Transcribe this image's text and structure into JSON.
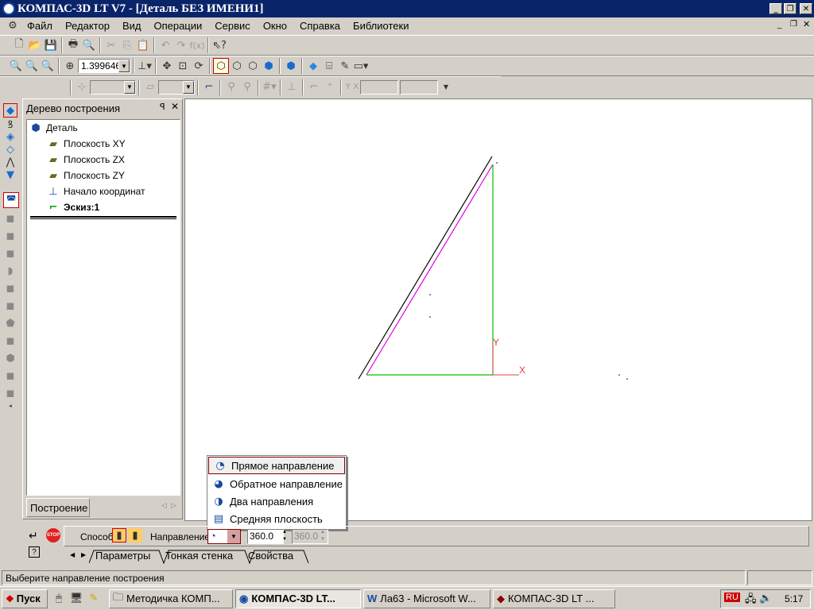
{
  "window": {
    "title": "КОМПАС-3D LT V7 - [Деталь БЕЗ ИМЕНИ1]"
  },
  "menu": [
    "Файл",
    "Редактор",
    "Вид",
    "Операции",
    "Сервис",
    "Окно",
    "Справка",
    "Библиотеки"
  ],
  "toolbar": {
    "zoom_value": "1.399646"
  },
  "tree": {
    "title": "Дерево построения",
    "root": "Деталь",
    "items": [
      "Плоскость XY",
      "Плоскость ZX",
      "Плоскость ZY",
      "Начало координат",
      "Эскиз:1"
    ],
    "tab": "Построение"
  },
  "canvas": {
    "axis_x": "X",
    "axis_y": "Y"
  },
  "context_menu": [
    "Прямое направление",
    "Обратное направление",
    "Два направления",
    "Средняя плоскость"
  ],
  "properties": {
    "method_label": "Способ",
    "direction_label": "Направление",
    "angle_value": "360.0",
    "angle_value2": "360.0",
    "tabs": [
      "Параметры",
      "Тонкая стенка",
      "Свойства"
    ]
  },
  "status": {
    "text": "Выберите направление построения"
  },
  "taskbar": {
    "start": "Пуск",
    "items": [
      "Методичка КОМП...",
      "КОМПАС-3D LT...",
      "Ла63 - Microsoft W...",
      "КОМПАС-3D LT ..."
    ],
    "lang": "RU",
    "clock": "5:17"
  },
  "colors": {
    "titlebar": "#0a246a",
    "sketch_green": "#00c000",
    "magenta": "#e000e0",
    "axis_red": "#e04040"
  }
}
